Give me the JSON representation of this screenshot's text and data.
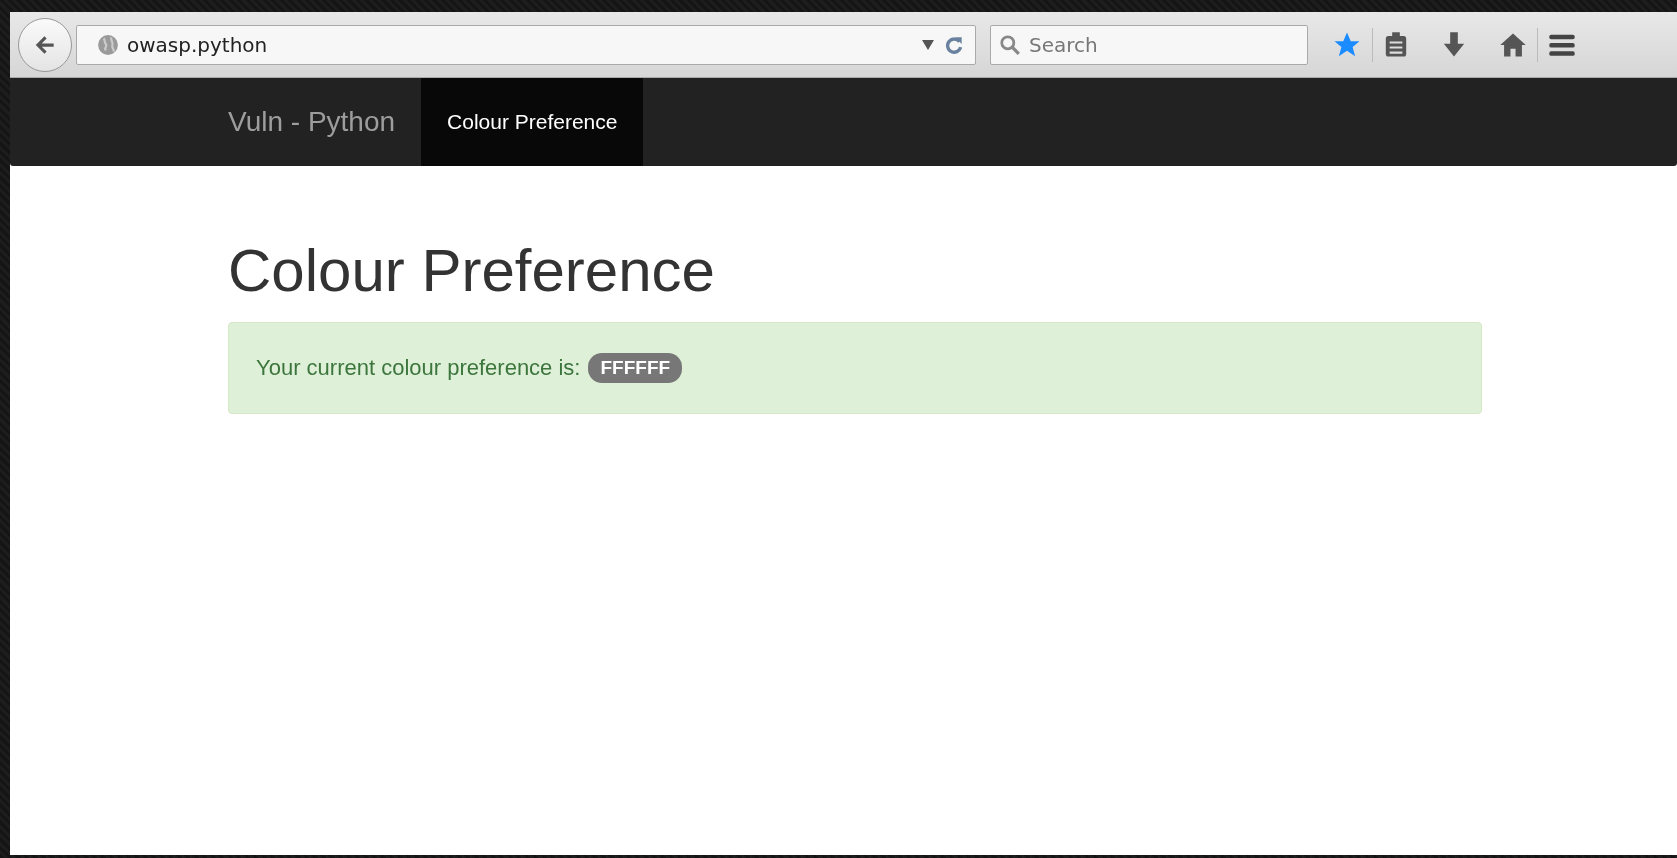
{
  "browser": {
    "url": "owasp.python",
    "search": {
      "placeholder": "Search"
    }
  },
  "navbar": {
    "brand": "Vuln - Python",
    "items": [
      {
        "label": "Colour Preference",
        "selected": true
      }
    ]
  },
  "heading": "Colour Preference",
  "alert": {
    "message": "Your current colour preference is:",
    "badge": "FFFFFF"
  }
}
